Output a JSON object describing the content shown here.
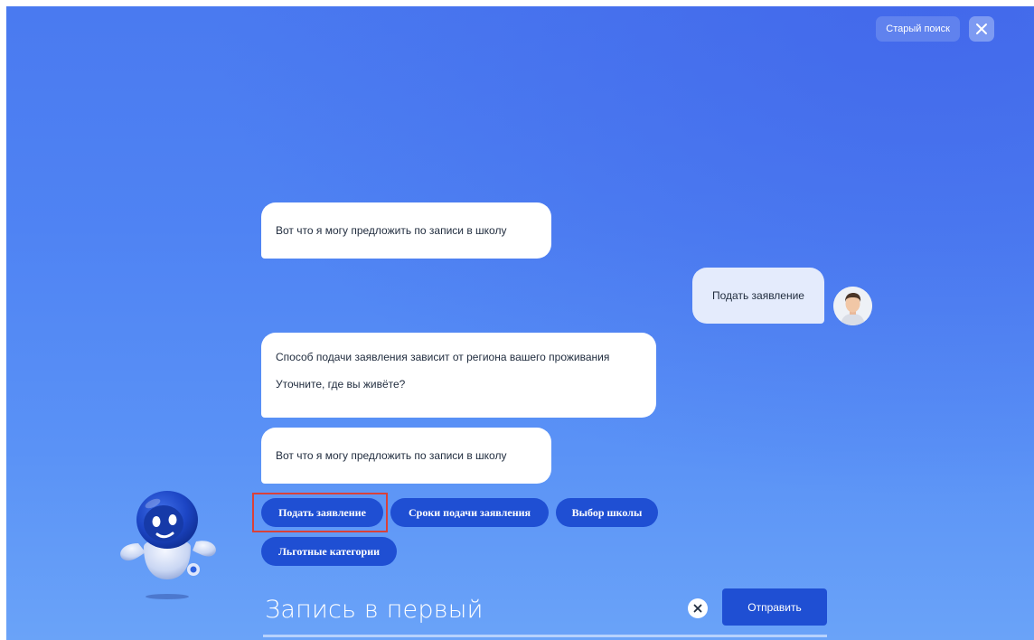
{
  "header": {
    "old_search_label": "Старый поиск",
    "close_icon": "close-icon"
  },
  "chat": {
    "messages": [
      {
        "sender": "bot",
        "lines": [
          "Вот что я могу предложить по записи в школу"
        ]
      },
      {
        "sender": "user",
        "lines": [
          "Подать заявление"
        ]
      },
      {
        "sender": "bot",
        "lines": [
          "Способ подачи заявления зависит от региона вашего проживания",
          "Уточните, где вы живёте?"
        ]
      },
      {
        "sender": "bot",
        "lines": [
          "Вот что я могу предложить по записи в школу"
        ]
      }
    ],
    "quick_replies": [
      "Подать заявление",
      "Сроки подачи заявления",
      "Выбор школы",
      "Льготные категории"
    ]
  },
  "input": {
    "value": "Запись в первый",
    "clear_icon": "clear-icon",
    "send_label": "Отправить"
  },
  "colors": {
    "background_top": "#4a7af0",
    "background_bottom": "#6aa3f8",
    "chip": "#1f4fd3",
    "send_button": "#1f4fd3",
    "highlight_frame": "#d9413a"
  }
}
